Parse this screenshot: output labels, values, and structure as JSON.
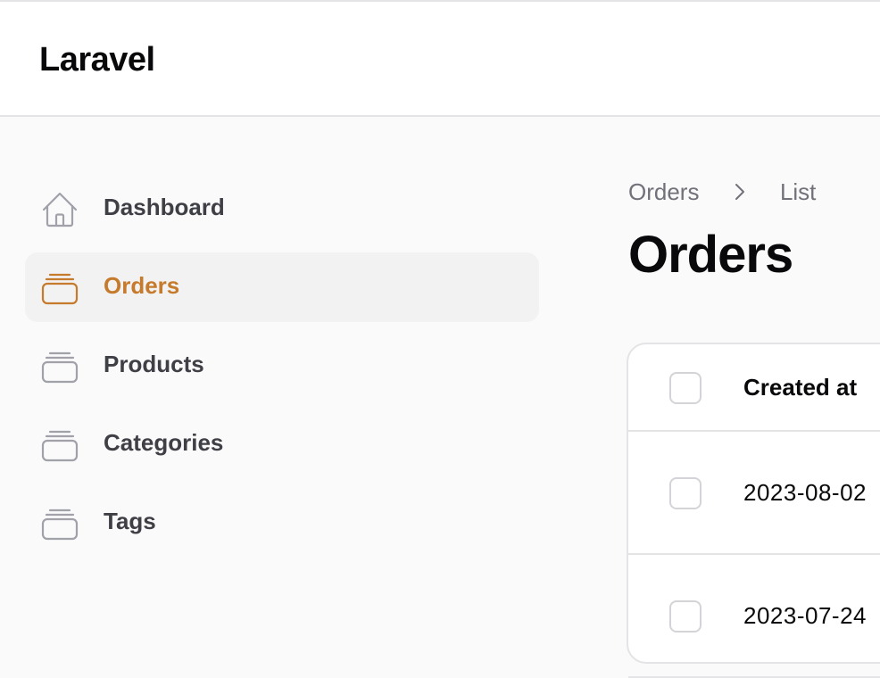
{
  "app": {
    "brand": "Laravel"
  },
  "sidebar": {
    "items": [
      {
        "label": "Dashboard",
        "icon": "home-icon",
        "active": false
      },
      {
        "label": "Orders",
        "icon": "stack-icon",
        "active": true
      },
      {
        "label": "Products",
        "icon": "stack-icon",
        "active": false
      },
      {
        "label": "Categories",
        "icon": "stack-icon",
        "active": false
      },
      {
        "label": "Tags",
        "icon": "stack-icon",
        "active": false
      }
    ]
  },
  "breadcrumb": {
    "items": [
      "Orders",
      "List"
    ]
  },
  "page": {
    "title": "Orders"
  },
  "table": {
    "columns": [
      "Created at"
    ],
    "rows": [
      {
        "created_at": "2023-08-02"
      },
      {
        "created_at": "2023-07-24"
      }
    ]
  },
  "colors": {
    "accent": "#c67a2c",
    "icon": "#a1a1aa",
    "text": "#3f3f46",
    "border": "#e4e4e7"
  }
}
